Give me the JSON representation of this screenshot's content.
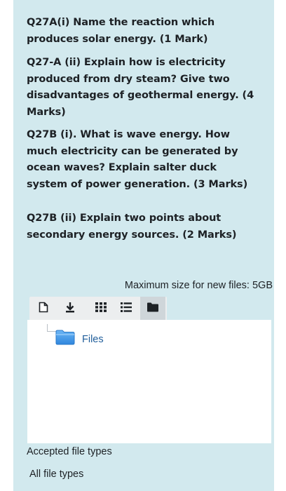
{
  "questions": [
    "Q27A(i) Name the reaction which produces solar energy. (1 Mark)",
    "Q27-A (ii) Explain how is electricity produced from dry steam? Give two disadvantages of geothermal energy. (4 Marks)",
    "Q27B (i). What is wave energy. How much electricity can be generated by ocean waves? Explain salter duck system of power generation. (3 Marks)",
    "Q27B (ii) Explain two points about secondary energy sources. (2 Marks)"
  ],
  "filepicker": {
    "max_size": "Maximum size for new files: 5GB",
    "toolbar_icons": [
      "new-file-icon",
      "download-icon",
      "grid-view-icon",
      "list-view-icon",
      "folder-tree-icon"
    ],
    "folder_label": "Files"
  },
  "accepted": {
    "label": "Accepted file types",
    "value": "All file types"
  },
  "colors": {
    "panel_bg": "#d2e9ee",
    "text": "#1d2125",
    "link": "#1f5d9a"
  }
}
